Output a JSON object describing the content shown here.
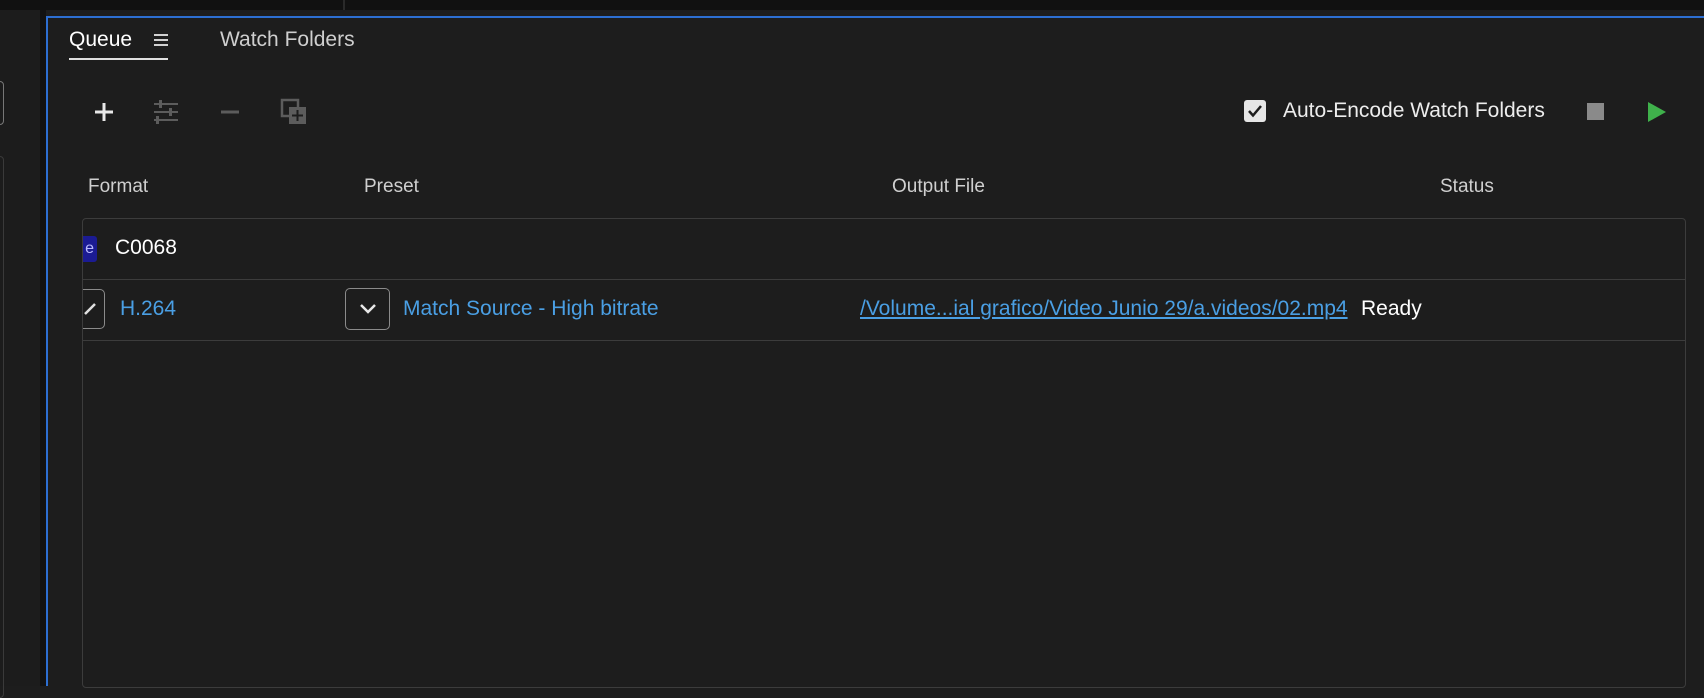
{
  "tabs": [
    {
      "label": "Queue",
      "active": true
    },
    {
      "label": "Watch Folders",
      "active": false
    }
  ],
  "toolbar": {
    "add_icon": "plus-icon",
    "settings_icon": "sliders-icon",
    "remove_icon": "minus-icon",
    "duplicate_icon": "duplicate-icon",
    "auto_encode": {
      "label": "Auto-Encode Watch Folders",
      "checked": true
    },
    "stop_icon": "stop-icon",
    "start_icon": "play-icon"
  },
  "columns": {
    "format": "Format",
    "preset": "Preset",
    "output": "Output File",
    "status": "Status"
  },
  "queue": {
    "source": {
      "badge": "e",
      "name": "C0068"
    },
    "items": [
      {
        "format": "H.264",
        "preset": "Match Source - High bitrate",
        "output": "/Volume...ial grafico/Video Junio 29/a.videos/02.mp4",
        "status": "Ready"
      }
    ]
  },
  "colors": {
    "accent_blue": "#4a9fe4",
    "panel_border": "#2d6fd2",
    "play_green": "#3fb14b",
    "background": "#1d1d1d"
  }
}
